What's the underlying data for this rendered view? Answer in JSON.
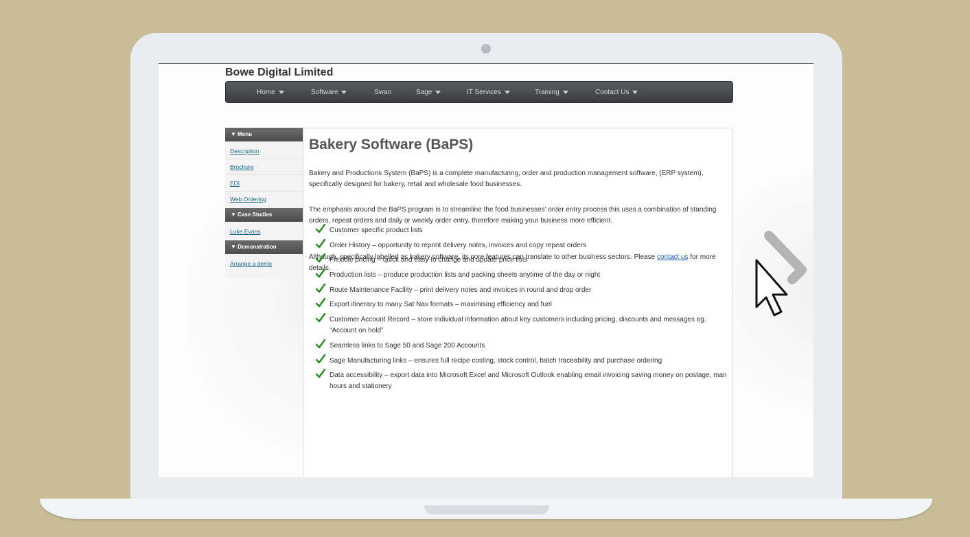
{
  "site": {
    "title": "Bowe Digital Limited"
  },
  "nav": [
    {
      "label": "Home",
      "dropdown": true
    },
    {
      "label": "Software",
      "dropdown": true
    },
    {
      "label": "Swan",
      "dropdown": false
    },
    {
      "label": "Sage",
      "dropdown": true
    },
    {
      "label": "IT Services",
      "dropdown": true
    },
    {
      "label": "Training",
      "dropdown": true
    },
    {
      "label": "Contact Us",
      "dropdown": true
    }
  ],
  "sidebar": {
    "menu_heading": "▼ Menu",
    "menu_links": [
      "Description",
      "Brochure",
      "EDI",
      "Web Ordering"
    ],
    "case_heading": "▼ Case Studies",
    "case_links": [
      "Luke Evans"
    ],
    "demo_heading": "▼ Demonstration",
    "demo_links": [
      "Arrange a demo"
    ]
  },
  "main": {
    "heading": "Bakery Software (BaPS)",
    "para1": "Bakery and Productions System (BaPS) is a complete manufacturing, order and production management software, (ERP system), specifically designed for bakery, retail and wholesale food businesses.",
    "para2": "The emphasis around the BaPS program is to streamline the food businesses' order entry process this uses a combination of standing orders, repeat orders and daily or weekly order entry, therefore making your business more efficient.",
    "para3_before": "Although, specifically labelled as bakery software, its core features can translate to other business sectors. Please ",
    "para3_link": "contact us",
    "para3_after": " for more details.",
    "features": [
      "Customer specific product lists",
      "Order History – opportunity to reprint delivery notes, invoices and copy repeat orders",
      "Flexible pricing – quick and easy to change and update price lists",
      "Production lists – produce production lists and packing sheets anytime of the day or night",
      "Route Maintenance Facility – print delivery notes and invoices in round and drop order",
      "Export itinerary to many Sat Nav formats – maximising efficiency and fuel",
      "Customer Account Record – store individual information about key customers including pricing, discounts and messages eg. “Account on hold”",
      "Seamless links to Sage 50 and Sage 200 Accounts",
      "Sage Manufacturing links – ensures full recipe costing, stock control, batch traceability and purchase ordering",
      "Data accessibility – export data into Microsoft Excel and Microsoft Outlook enabling email invoicing saving money on postage, man hours and stationery"
    ]
  },
  "icons": {
    "check": "checkmark-icon",
    "cursor": "mouse-pointer-icon",
    "next": "chevron-right-icon"
  },
  "colors": {
    "background": "#c8bd97",
    "link": "#1f6a8a",
    "check": "#2e8b2e",
    "nav": "#4a4c4f"
  }
}
